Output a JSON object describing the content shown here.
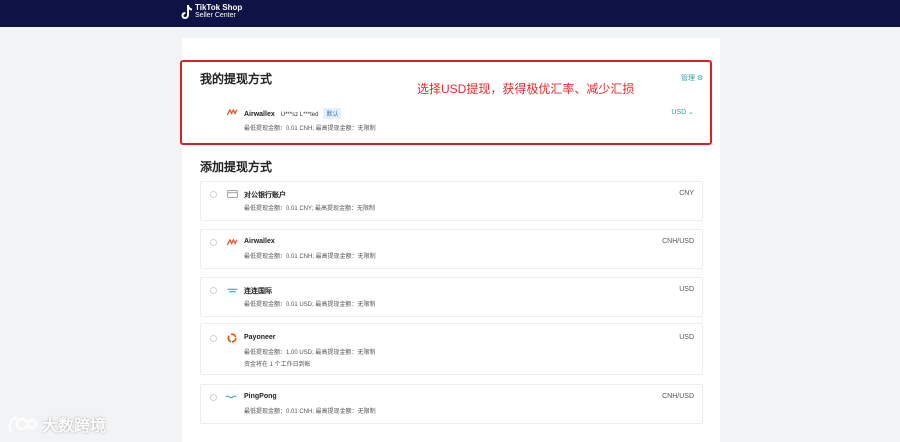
{
  "header": {
    "logo_line1": "TikTok Shop",
    "logo_line2": "Seller Center"
  },
  "my_methods": {
    "title": "我的提现方式",
    "manage_label": "管理",
    "annotation": "选择USD提现，获得极优汇率、减少汇损",
    "item": {
      "name": "Airwallex",
      "account": "U***sz L***ted",
      "default_tag": "默认",
      "limits": "最低提现金额：0.01 CNH; 最高提现金额：无限制",
      "currency": "USD"
    }
  },
  "add_methods": {
    "title": "添加提现方式",
    "items": [
      {
        "name": "对公银行账户",
        "limits": "最低提现金额：0.01 CNY; 最高提现金额：无限制",
        "extra": "",
        "currency": "CNY",
        "icon": "bank-card-icon"
      },
      {
        "name": "Airwallex",
        "limits": "最低提现金额：0.01 CNH; 最高提现金额：无限制",
        "extra": "",
        "currency": "CNH/USD",
        "icon": "airwallex-icon"
      },
      {
        "name": "连连国际",
        "limits": "最低提现金额：0.01 USD; 最高提现金额：无限制",
        "extra": "",
        "currency": "USD",
        "icon": "lianlian-icon"
      },
      {
        "name": "Payoneer",
        "limits": "最低提现金额：1.00 USD; 最高提现金额：无限制",
        "extra": "资金将在 1 个工作日到帐",
        "currency": "USD",
        "icon": "payoneer-icon"
      },
      {
        "name": "PingPong",
        "limits": "最低提现金额：0.01 CNH; 最高提现金额：无限制",
        "extra": "",
        "currency": "CNH/USD",
        "icon": "pingpong-icon"
      }
    ]
  },
  "watermark": {
    "text": "大数跨境"
  },
  "colors": {
    "header_bg": "#0e1244",
    "highlight": "#e02020",
    "accent": "#35a0a0"
  }
}
